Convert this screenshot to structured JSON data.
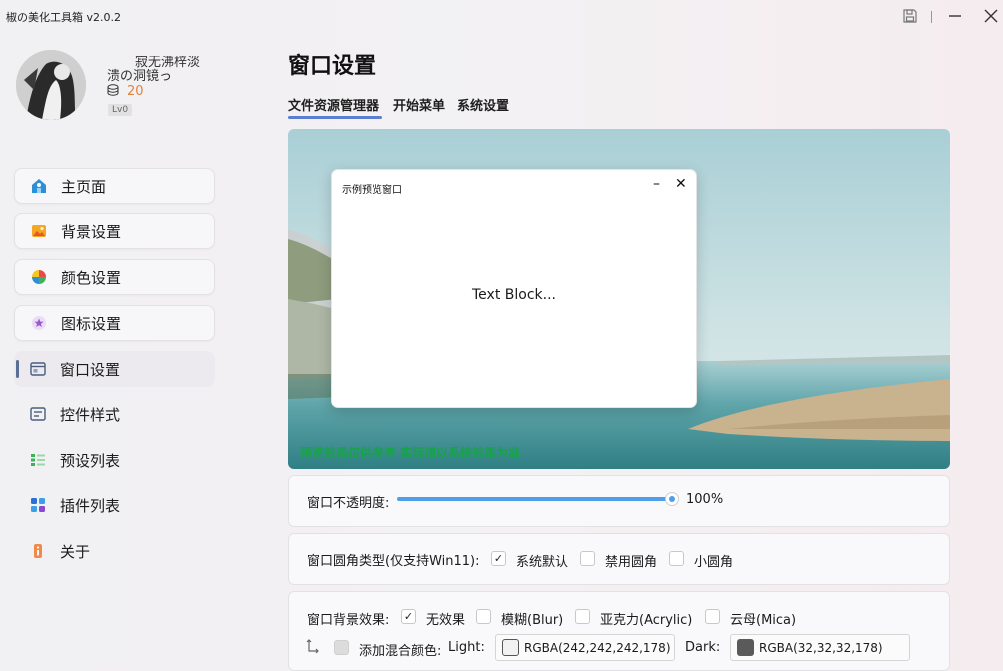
{
  "app": {
    "title": "椒の美化工具箱 v2.0.2"
  },
  "profile": {
    "name_line1": "寂无沸梓淡",
    "name_line2": "溃の洞镜っ",
    "coins": "20",
    "level": "Lv0"
  },
  "nav": {
    "items": [
      {
        "label": "主页面",
        "icon": "home-icon"
      },
      {
        "label": "背景设置",
        "icon": "image-icon"
      },
      {
        "label": "颜色设置",
        "icon": "palette-icon"
      },
      {
        "label": "图标设置",
        "icon": "star-icon"
      },
      {
        "label": "窗口设置",
        "icon": "window-icon"
      },
      {
        "label": "控件样式",
        "icon": "controls-icon"
      },
      {
        "label": "预设列表",
        "icon": "list-icon"
      },
      {
        "label": "插件列表",
        "icon": "plugins-icon"
      },
      {
        "label": "关于",
        "icon": "info-icon"
      }
    ],
    "selected": "窗口设置"
  },
  "page": {
    "title": "窗口设置",
    "tabs": [
      "文件资源管理器",
      "开始菜单",
      "系统设置"
    ],
    "active_tab": "文件资源管理器"
  },
  "preview": {
    "note": "预览效果仅供参考 实际请以系统效果为准",
    "window_title": "示例预览窗口",
    "text_block": "Text Block..."
  },
  "opacity": {
    "label": "窗口不透明度:",
    "value": 1.0,
    "value_text": "100%"
  },
  "corner": {
    "label": "窗口圆角类型(仅支持Win11):",
    "options": [
      {
        "label": "系统默认",
        "checked": true
      },
      {
        "label": "禁用圆角",
        "checked": false
      },
      {
        "label": "小圆角",
        "checked": false
      }
    ]
  },
  "backdrop": {
    "label": "窗口背景效果:",
    "options": [
      {
        "label": "无效果",
        "checked": true
      },
      {
        "label": "模糊(Blur)",
        "checked": false
      },
      {
        "label": "亚克力(Acrylic)",
        "checked": false
      },
      {
        "label": "云母(Mica)",
        "checked": false
      }
    ],
    "blend_label": "添加混合颜色:",
    "light_label": "Light:",
    "light_value": "RGBA(242,242,242,178)",
    "light_color": "#f2f2f2",
    "dark_label": "Dark:",
    "dark_value": "RGBA(32,32,32,178)",
    "dark_color": "#202020"
  },
  "colors": {
    "accent": "#4f9fe8",
    "tab_underline": "#5b7fd0",
    "coin": "#e0823f",
    "note": "#17a34a"
  }
}
